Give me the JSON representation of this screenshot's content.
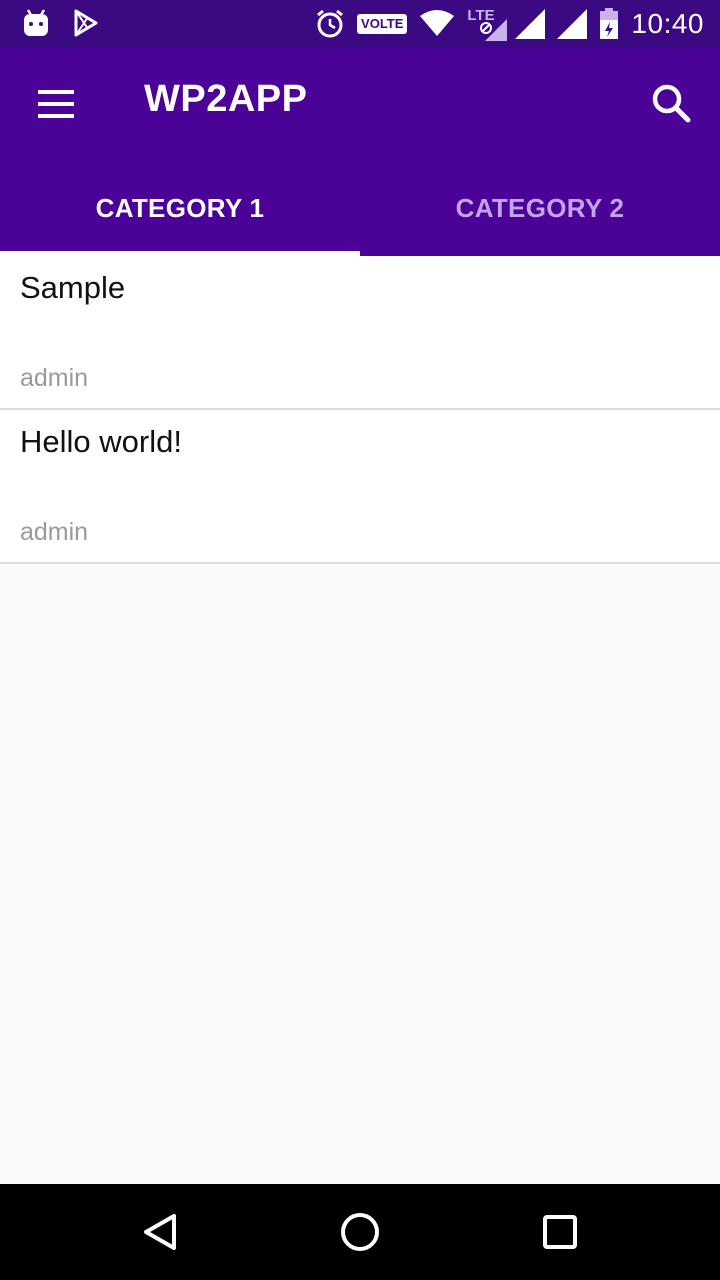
{
  "status_bar": {
    "left_icons": [
      "android-notification-icon",
      "play-store-icon"
    ],
    "right_icons": [
      "alarm-icon",
      "volte-badge",
      "wifi-icon",
      "lte-icon",
      "signal-icon",
      "signal-icon",
      "battery-icon"
    ],
    "volte_label": "VOLTE",
    "lte_label": "LTE",
    "time": "10:40"
  },
  "app_bar": {
    "title": "WP2APP",
    "menu_icon": "hamburger-menu-icon",
    "search_icon": "search-icon",
    "background": "#4a0297"
  },
  "tabs": [
    {
      "label": "CATEGORY 1",
      "selected": true
    },
    {
      "label": "CATEGORY 2",
      "selected": false
    }
  ],
  "posts": [
    {
      "title": "Sample",
      "author": "admin"
    },
    {
      "title": "Hello world!",
      "author": "admin"
    }
  ],
  "nav_bar": {
    "buttons": [
      "back-icon",
      "home-icon",
      "recents-icon"
    ]
  },
  "colors": {
    "status_bar": "#3b0a82",
    "primary": "#4a0297",
    "tab_inactive": "#c3a4e6",
    "background": "#fafafa"
  }
}
